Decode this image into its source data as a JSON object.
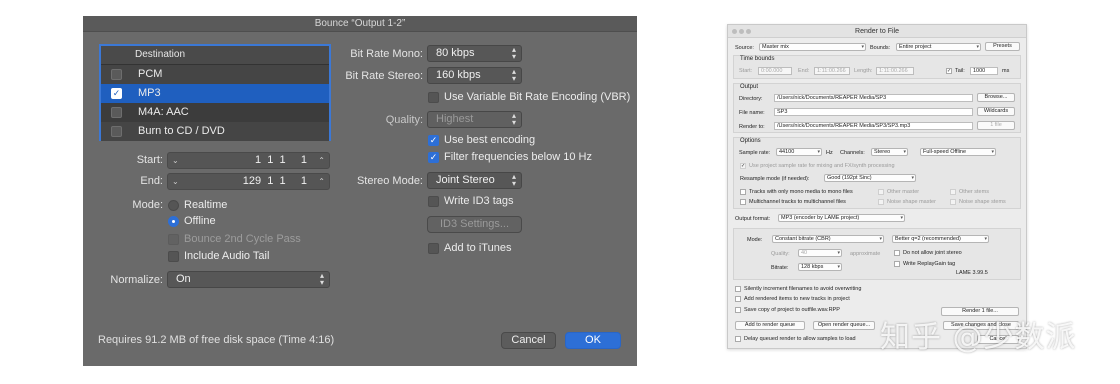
{
  "bounce": {
    "title": "Bounce “Output 1-2”",
    "destination": {
      "header": "Destination",
      "items": [
        {
          "label": "PCM",
          "checked": false
        },
        {
          "label": "MP3",
          "checked": true
        },
        {
          "label": "M4A: AAC",
          "checked": false
        },
        {
          "label": "Burn to CD / DVD",
          "checked": false
        }
      ]
    },
    "start": {
      "label": "Start:",
      "value": "1  1  1     1"
    },
    "end": {
      "label": "End:",
      "value": "129  1  1     1"
    },
    "mode": {
      "label": "Mode:",
      "realtime": "Realtime",
      "offline": "Offline",
      "selected": "Offline"
    },
    "bounce_2nd_cycle": "Bounce 2nd Cycle Pass",
    "include_audio_tail": "Include Audio Tail",
    "normalize": {
      "label": "Normalize:",
      "value": "On"
    },
    "bit_rate_mono": {
      "label": "Bit Rate Mono:",
      "value": "80 kbps"
    },
    "bit_rate_stereo": {
      "label": "Bit Rate Stereo:",
      "value": "160 kbps"
    },
    "vbr": "Use Variable Bit Rate Encoding (VBR)",
    "quality": {
      "label": "Quality:",
      "value": "Highest"
    },
    "best_encoding": "Use best encoding",
    "filter": "Filter frequencies below 10 Hz",
    "stereo_mode": {
      "label": "Stereo Mode:",
      "value": "Joint Stereo"
    },
    "id3_tags": "Write ID3 tags",
    "id3_settings": "ID3 Settings...",
    "add_itunes": "Add to iTunes",
    "disk_info": "Requires 91.2 MB of free disk space  (Time 4:16)",
    "cancel": "Cancel",
    "ok": "OK",
    "colors": {
      "background": "#6a6a6a",
      "accent": "#2d6fd6"
    }
  },
  "render": {
    "title": "Render to File",
    "source_label": "Source:",
    "source_value": "Master mix",
    "bounds_label": "Bounds:",
    "bounds_value": "Entire project",
    "presets": "Presets",
    "time_bounds": "Time bounds",
    "start_label": "Start:",
    "start_value": "0:00.000",
    "end_label": "End:",
    "end_value": "1:11:00.266",
    "length_label": "Length:",
    "length_value": "1:11:00.266",
    "tail_label": "Tail:",
    "tail_value": "1000",
    "tail_unit": "ms",
    "output": "Output",
    "directory_label": "Directory:",
    "directory_value": "/Users/nick/Documents/REAPER Media/SP3",
    "browse": "Browse...",
    "filename_label": "File name:",
    "filename_value": "SP3",
    "wildcards": "Wildcards",
    "renderto_label": "Render to:",
    "renderto_value": "/Users/nick/Documents/REAPER Media/SP3/SP3.mp3",
    "one_file": "1 file",
    "options": "Options",
    "samplerate_label": "Sample rate:",
    "samplerate_value": "44100",
    "hz": "Hz",
    "channels_label": "Channels:",
    "channels_value": "Stereo",
    "speed_value": "Full-speed Offline",
    "use_project_rate": "Use project sample rate for mixing and FX/synth processing",
    "resample_label": "Resample mode (if needed):",
    "resample_value": "Good (192pt Sinc)",
    "mono_tracks": "Tracks with only mono media to mono files",
    "multichannel": "Multichannel tracks to multichannel files",
    "other_master": "Other master",
    "noise_master": "Noise shape master",
    "other_stems": "Other stems",
    "noise_stems": "Noise shape stems",
    "output_format_label": "Output format:",
    "output_format_value": "MP3 (encoder by LAME project)",
    "mode_label": "Mode:",
    "mode_value": "Constant bitrate  (CBR)",
    "quality_value": "Better q=2 (recommended)",
    "quality_label": "Quality:",
    "quality_num": "40",
    "approximate": "approximate",
    "no_joint_stereo": "Do not allow joint stereo",
    "bitrate_label": "Bitrate:",
    "bitrate_value": "128 kbps",
    "replaygain": "Write ReplayGain tag",
    "lame_version": "LAME 3.99.5",
    "silently_increment": "Silently increment filenames to avoid overwriting",
    "add_rendered": "Add rendered items to new tracks in project",
    "save_copy": "Save copy of project to outfile.wav.RPP",
    "render_button": "Render 1 file...",
    "add_queue": "Add to render queue",
    "open_queue": "Open render queue...",
    "save_changes": "Save changes and close",
    "delay_queued": "Delay queued render to allow samples to load",
    "cancel": "Cancel"
  },
  "watermark": "知乎 @少数派"
}
